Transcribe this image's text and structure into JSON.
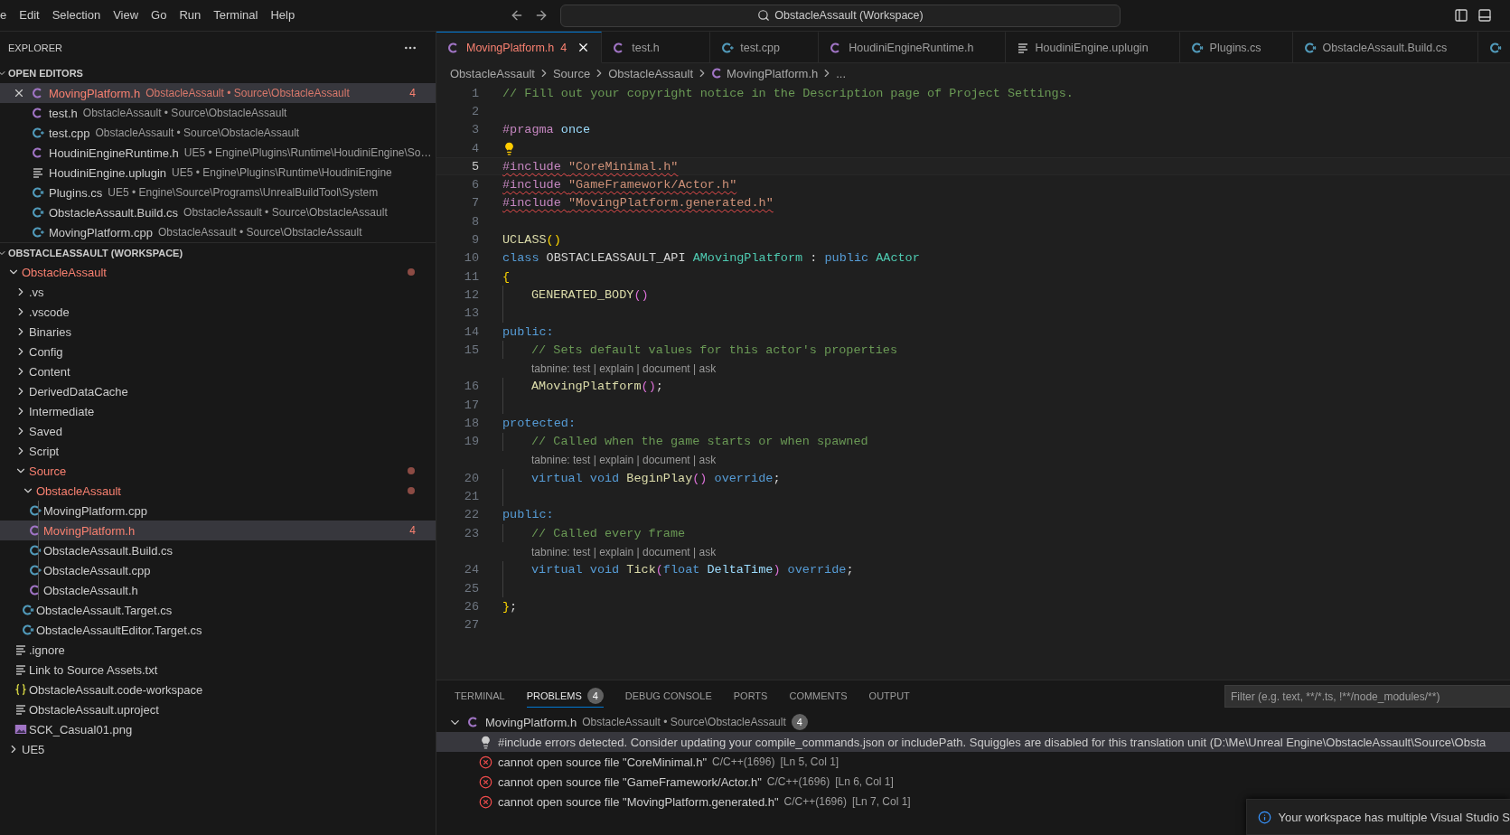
{
  "menu": [
    {
      "label": "e"
    },
    {
      "label": "Edit"
    },
    {
      "label": "Selection"
    },
    {
      "label": "View"
    },
    {
      "label": "Go"
    },
    {
      "label": "Run"
    },
    {
      "label": "Terminal"
    },
    {
      "label": "Help"
    }
  ],
  "command_center": {
    "text": "ObstacleAssault (Workspace)"
  },
  "sidebar": {
    "title": "EXPLORER",
    "open_editors": {
      "title": "OPEN EDITORS",
      "expanded": true,
      "items": [
        {
          "name": "MovingPlatform.h",
          "description": "ObstacleAssault • Source\\ObstacleAssault",
          "kind": "c",
          "error": true,
          "badge": "4",
          "selected": true
        },
        {
          "name": "test.h",
          "description": "ObstacleAssault • Source\\ObstacleAssault",
          "kind": "c",
          "error": false,
          "selected": false
        },
        {
          "name": "test.cpp",
          "description": "ObstacleAssault • Source\\ObstacleAssault",
          "kind": "cpp",
          "error": false,
          "selected": false
        },
        {
          "name": "HoudiniEngineRuntime.h",
          "description": "UE5 • Engine\\Plugins\\Runtime\\HoudiniEngine\\So…",
          "kind": "c",
          "error": false,
          "selected": false
        },
        {
          "name": "HoudiniEngine.uplugin",
          "description": "UE5 • Engine\\Plugins\\Runtime\\HoudiniEngine",
          "kind": "text",
          "error": false,
          "selected": false
        },
        {
          "name": "Plugins.cs",
          "description": "UE5 • Engine\\Source\\Programs\\UnrealBuildTool\\System",
          "kind": "cs",
          "error": false,
          "selected": false
        },
        {
          "name": "ObstacleAssault.Build.cs",
          "description": "ObstacleAssault • Source\\ObstacleAssault",
          "kind": "cs",
          "error": false,
          "selected": false
        },
        {
          "name": "MovingPlatform.cpp",
          "description": "ObstacleAssault • Source\\ObstacleAssault",
          "kind": "cpp",
          "error": false,
          "selected": false
        }
      ]
    },
    "workspace": {
      "title": "OBSTACLEASSAULT (WORKSPACE)",
      "expanded": true,
      "tree": [
        {
          "name": "ObstacleAssault",
          "kind": "folder",
          "expanded": true,
          "error": true,
          "selected": false,
          "children": [
            {
              "name": ".vs",
              "kind": "folder",
              "expanded": false,
              "error": false,
              "selected": false
            },
            {
              "name": ".vscode",
              "kind": "folder",
              "expanded": false,
              "error": false,
              "selected": false
            },
            {
              "name": "Binaries",
              "kind": "folder",
              "expanded": false,
              "error": false,
              "selected": false
            },
            {
              "name": "Config",
              "kind": "folder",
              "expanded": false,
              "error": false,
              "selected": false
            },
            {
              "name": "Content",
              "kind": "folder",
              "expanded": false,
              "error": false,
              "selected": false
            },
            {
              "name": "DerivedDataCache",
              "kind": "folder",
              "expanded": false,
              "error": false,
              "selected": false
            },
            {
              "name": "Intermediate",
              "kind": "folder",
              "expanded": false,
              "error": false,
              "selected": false
            },
            {
              "name": "Saved",
              "kind": "folder",
              "expanded": false,
              "error": false,
              "selected": false
            },
            {
              "name": "Script",
              "kind": "folder",
              "expanded": false,
              "error": false,
              "selected": false
            },
            {
              "name": "Source",
              "kind": "folder",
              "expanded": true,
              "error": true,
              "selected": false,
              "children": [
                {
                  "name": "ObstacleAssault",
                  "kind": "folder",
                  "expanded": true,
                  "error": true,
                  "selected": false,
                  "children": [
                    {
                      "name": "MovingPlatform.cpp",
                      "kind": "cpp",
                      "error": false,
                      "selected": false
                    },
                    {
                      "name": "MovingPlatform.h",
                      "kind": "c",
                      "error": true,
                      "badge": "4",
                      "selected": true
                    },
                    {
                      "name": "ObstacleAssault.Build.cs",
                      "kind": "cs",
                      "error": false,
                      "selected": false
                    },
                    {
                      "name": "ObstacleAssault.cpp",
                      "kind": "cpp",
                      "error": false,
                      "selected": false
                    },
                    {
                      "name": "ObstacleAssault.h",
                      "kind": "c",
                      "error": false,
                      "selected": false
                    }
                  ]
                },
                {
                  "name": "ObstacleAssault.Target.cs",
                  "kind": "cs",
                  "error": false,
                  "selected": false
                },
                {
                  "name": "ObstacleAssaultEditor.Target.cs",
                  "kind": "cs",
                  "error": false,
                  "selected": false
                }
              ]
            },
            {
              "name": ".ignore",
              "kind": "text",
              "error": false,
              "selected": false
            },
            {
              "name": "Link to Source Assets.txt",
              "kind": "text",
              "error": false,
              "selected": false
            },
            {
              "name": "ObstacleAssault.code-workspace",
              "kind": "json",
              "error": false,
              "selected": false
            },
            {
              "name": "ObstacleAssault.uproject",
              "kind": "text",
              "error": false,
              "selected": false
            },
            {
              "name": "SCK_Casual01.png",
              "kind": "image",
              "error": false,
              "selected": false
            }
          ]
        },
        {
          "name": "UE5",
          "kind": "folder",
          "expanded": false,
          "error": false,
          "selected": false
        }
      ]
    }
  },
  "editor_tabs": [
    {
      "label": "MovingPlatform.h",
      "kind": "c",
      "badge": "4",
      "error": true,
      "selected": true
    },
    {
      "label": "test.h",
      "kind": "c",
      "error": false,
      "selected": false
    },
    {
      "label": "test.cpp",
      "kind": "cpp",
      "error": false,
      "selected": false
    },
    {
      "label": "HoudiniEngineRuntime.h",
      "kind": "c",
      "error": false,
      "selected": false
    },
    {
      "label": "HoudiniEngine.uplugin",
      "kind": "text",
      "error": false,
      "selected": false
    },
    {
      "label": "Plugins.cs",
      "kind": "cs",
      "error": false,
      "selected": false
    },
    {
      "label": "ObstacleAssault.Build.cs",
      "kind": "cs",
      "error": false,
      "selected": false
    },
    {
      "kind": "cs",
      "selected": false
    }
  ],
  "breadcrumb": [
    {
      "label": "ObstacleAssault",
      "kind": "folder"
    },
    {
      "label": "Source",
      "kind": "folder"
    },
    {
      "label": "ObstacleAssault",
      "kind": "folder"
    },
    {
      "label": "MovingPlatform.h",
      "kind": "c"
    },
    {
      "label": "...",
      "kind": "symbols"
    }
  ],
  "code_lines": [
    {
      "kind": "code",
      "number": "1",
      "tokens": [
        {
          "kind": "comment",
          "text": "// Fill out your copyright notice in the Description page of Project Settings."
        }
      ]
    },
    {
      "kind": "code",
      "number": "2"
    },
    {
      "kind": "code",
      "number": "3",
      "tokens": [
        {
          "kind": "directive",
          "text": "#pragma "
        },
        {
          "kind": "var",
          "text": "once"
        }
      ]
    },
    {
      "kind": "code",
      "number": "4",
      "lightbulb": true
    },
    {
      "kind": "code",
      "number": "5",
      "current": true,
      "error": true,
      "tokens": [
        {
          "kind": "directive",
          "text": "#include "
        },
        {
          "kind": "string",
          "text": "\"CoreMinimal.h\""
        }
      ]
    },
    {
      "kind": "code",
      "number": "6",
      "error": true,
      "tokens": [
        {
          "kind": "directive",
          "text": "#include "
        },
        {
          "kind": "string",
          "text": "\"GameFramework/Actor.h\""
        }
      ]
    },
    {
      "kind": "code",
      "number": "7",
      "error": true,
      "tokens": [
        {
          "kind": "directive",
          "text": "#include "
        },
        {
          "kind": "string",
          "text": "\"MovingPlatform.generated.h\""
        }
      ]
    },
    {
      "kind": "code",
      "number": "8"
    },
    {
      "kind": "code",
      "number": "9",
      "tokens": [
        {
          "kind": "func",
          "text": "UCLASS"
        },
        {
          "kind": "bracket1",
          "text": "()"
        }
      ]
    },
    {
      "kind": "code",
      "number": "10",
      "tokens": [
        {
          "kind": "keyword",
          "text": "class "
        },
        {
          "kind": "plain",
          "text": "OBSTACLEASSAULT_API "
        },
        {
          "kind": "type",
          "text": "AMovingPlatform"
        },
        {
          "kind": "plain",
          "text": " : "
        },
        {
          "kind": "keyword",
          "text": "public "
        },
        {
          "kind": "type",
          "text": "AActor"
        }
      ]
    },
    {
      "kind": "code",
      "number": "11",
      "tokens": [
        {
          "kind": "bracket1",
          "text": "{"
        }
      ]
    },
    {
      "kind": "code",
      "number": "12",
      "indented": true,
      "tokens": [
        {
          "kind": "func",
          "text": "GENERATED_BODY"
        },
        {
          "kind": "bracket2",
          "text": "()"
        }
      ]
    },
    {
      "kind": "code",
      "number": "13",
      "indented": true
    },
    {
      "kind": "code",
      "number": "14",
      "tokens": [
        {
          "kind": "keyword",
          "text": "public:"
        }
      ]
    },
    {
      "kind": "code",
      "number": "15",
      "indented": true,
      "tokens": [
        {
          "kind": "comment",
          "text": "// Sets default values for this actor's properties"
        }
      ]
    },
    {
      "kind": "codelens",
      "text": "tabnine: test | explain | document | ask"
    },
    {
      "kind": "code",
      "number": "16",
      "indented": true,
      "tokens": [
        {
          "kind": "func",
          "text": "AMovingPlatform"
        },
        {
          "kind": "bracket2",
          "text": "()"
        },
        {
          "kind": "plain",
          "text": ";"
        }
      ]
    },
    {
      "kind": "code",
      "number": "17",
      "indented": true
    },
    {
      "kind": "code",
      "number": "18",
      "tokens": [
        {
          "kind": "keyword",
          "text": "protected:"
        }
      ]
    },
    {
      "kind": "code",
      "number": "19",
      "indented": true,
      "tokens": [
        {
          "kind": "comment",
          "text": "// Called when the game starts or when spawned"
        }
      ]
    },
    {
      "kind": "codelens",
      "text": "tabnine: test | explain | document | ask"
    },
    {
      "kind": "code",
      "number": "20",
      "indented": true,
      "tokens": [
        {
          "kind": "keyword",
          "text": "virtual void "
        },
        {
          "kind": "func",
          "text": "BeginPlay"
        },
        {
          "kind": "bracket2",
          "text": "()"
        },
        {
          "kind": "keyword",
          "text": " override"
        },
        {
          "kind": "plain",
          "text": ";"
        }
      ]
    },
    {
      "kind": "code",
      "number": "21",
      "indented": true
    },
    {
      "kind": "code",
      "number": "22",
      "tokens": [
        {
          "kind": "keyword",
          "text": "public:"
        }
      ]
    },
    {
      "kind": "code",
      "number": "23",
      "indented": true,
      "tokens": [
        {
          "kind": "comment",
          "text": "// Called every frame"
        }
      ]
    },
    {
      "kind": "codelens",
      "text": "tabnine: test | explain | document | ask"
    },
    {
      "kind": "code",
      "number": "24",
      "indented": true,
      "tokens": [
        {
          "kind": "keyword",
          "text": "virtual void "
        },
        {
          "kind": "func",
          "text": "Tick"
        },
        {
          "kind": "bracket2",
          "text": "("
        },
        {
          "kind": "keyword",
          "text": "float "
        },
        {
          "kind": "var",
          "text": "DeltaTime"
        },
        {
          "kind": "bracket2",
          "text": ")"
        },
        {
          "kind": "keyword",
          "text": " override"
        },
        {
          "kind": "plain",
          "text": ";"
        }
      ]
    },
    {
      "kind": "code",
      "number": "25",
      "indented": true
    },
    {
      "kind": "code",
      "number": "26",
      "tokens": [
        {
          "kind": "bracket1",
          "text": "}"
        },
        {
          "kind": "plain",
          "text": ";"
        }
      ]
    },
    {
      "kind": "code",
      "number": "27"
    }
  ],
  "panel": {
    "tabs": [
      {
        "label": "TERMINAL",
        "selected": false
      },
      {
        "label": "PROBLEMS",
        "badge": "4",
        "selected": true
      },
      {
        "label": "DEBUG CONSOLE",
        "selected": false
      },
      {
        "label": "PORTS",
        "selected": false
      },
      {
        "label": "COMMENTS",
        "selected": false
      },
      {
        "label": "OUTPUT",
        "selected": false
      }
    ],
    "filter": {
      "placeholder": "Filter (e.g. text, **/*.ts, !**/node_modules/**)"
    },
    "groups": [
      {
        "file": "MovingPlatform.h",
        "kind": "c",
        "path": "ObstacleAssault • Source\\ObstacleAssault",
        "count": "4",
        "expanded": true,
        "problems": [
          {
            "kind": "info",
            "message": "#include errors detected. Consider updating your compile_commands.json or includePath. Squiggles are disabled for this translation unit (D:\\Me\\Unreal Engine\\ObstacleAssault\\Source\\Obsta",
            "selected": true
          },
          {
            "kind": "error",
            "message": "cannot open source file \"CoreMinimal.h\"",
            "source": "C/C++(1696)",
            "location": "[Ln 5, Col 1]",
            "selected": false
          },
          {
            "kind": "error",
            "message": "cannot open source file \"GameFramework/Actor.h\"",
            "source": "C/C++(1696)",
            "location": "[Ln 6, Col 1]",
            "selected": false
          },
          {
            "kind": "error",
            "message": "cannot open source file \"MovingPlatform.generated.h\"",
            "source": "C/C++(1696)",
            "location": "[Ln 7, Col 1]",
            "selected": false
          }
        ]
      }
    ]
  },
  "notification": {
    "kind": "info",
    "text": "Your workspace has multiple Visual Studio S"
  }
}
